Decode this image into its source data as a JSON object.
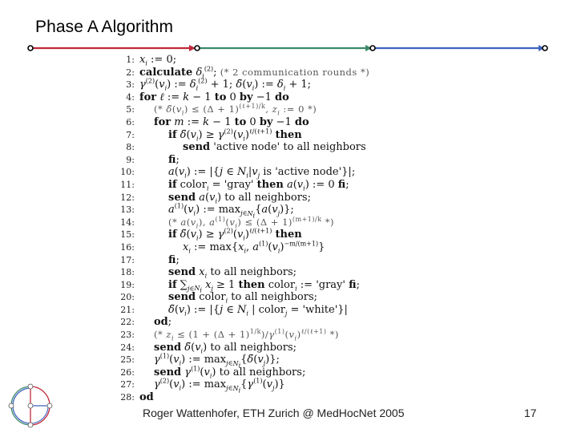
{
  "slide": {
    "title": "Phase A Algorithm",
    "footer": "Roger Wattenhofer, ETH Zurich @ MedHocNet 2005",
    "page_number": "17",
    "decor_colors": {
      "red": "#c0283a",
      "green": "#3a8a6a",
      "blue": "#3f63c0"
    }
  },
  "algorithm": {
    "lines": [
      {
        "n": "1:",
        "indent": 0,
        "html": "<i>x<sub>i</sub></i> := 0;"
      },
      {
        "n": "2:",
        "indent": 0,
        "html": "<b>calculate</b> <i>δ<sub>i</sub></i><sup>(2)</sup>; <span class='comment'>(* 2 communication rounds *)</span>"
      },
      {
        "n": "3:",
        "indent": 0,
        "html": "<i>γ</i><sup>(2)</sup>(<i>v<sub>i</sub></i>) := <i>δ<sub>i</sub></i><sup>(2)</sup> + 1; <i>δ̃</i>(<i>v<sub>i</sub></i>) := <i>δ<sub>i</sub></i> + 1;"
      },
      {
        "n": "4:",
        "indent": 0,
        "html": "<b>for</b> <i>ℓ</i> := <i>k</i> − 1 <b>to</b> 0 <b>by</b> −1 <b>do</b>"
      },
      {
        "n": "5:",
        "indent": 1,
        "html": "<span class='comment'>(* <i>δ̃</i>(<i>v<sub>i</sub></i>) ≤ (Δ + 1)<sup>(ℓ+1)/k</sup>, <i>z<sub>i</sub></i> := 0 *)</span>"
      },
      {
        "n": "6:",
        "indent": 1,
        "html": "<b>for</b> <i>m</i> := <i>k</i> − 1 <b>to</b> 0 <b>by</b> −1 <b>do</b>"
      },
      {
        "n": "7:",
        "indent": 2,
        "html": "<b>if</b> <i>δ̃</i>(<i>v<sub>i</sub></i>) ≥ <i>γ</i><sup>(2)</sup>(<i>v<sub>i</sub></i>)<sup>ℓ/(ℓ+1)</sup> <b>then</b>"
      },
      {
        "n": "8:",
        "indent": 3,
        "html": "<b>send</b> 'active node' to all neighbors"
      },
      {
        "n": "9:",
        "indent": 2,
        "html": "<b>fi</b>;"
      },
      {
        "n": "10:",
        "indent": 2,
        "html": "<i>a</i>(<i>v<sub>i</sub></i>) := |{<i>j</i> ∈ <i>N<sub>i</sub></i>|<i>v<sub>j</sub></i> is 'active node'}|;"
      },
      {
        "n": "11:",
        "indent": 2,
        "html": "<b>if</b> color<sub><i>i</i></sub> = 'gray' <b>then</b> <i>a</i>(<i>v<sub>i</sub></i>) := 0 <b>fi</b>;"
      },
      {
        "n": "12:",
        "indent": 2,
        "html": "<b>send</b> <i>a</i>(<i>v<sub>i</sub></i>) to all neighbors;"
      },
      {
        "n": "13:",
        "indent": 2,
        "html": "<i>a</i><sup>(1)</sup>(<i>v<sub>i</sub></i>) := max<sub><i>j</i>∈<i>N<sub>i</sub></i></sub>{<i>a</i>(<i>v<sub>j</sub></i>)};"
      },
      {
        "n": "14:",
        "indent": 2,
        "html": "<span class='comment'>(* <i>a</i>(<i>v<sub>i</sub></i>), <i>a</i><sup>(1)</sup>(<i>v<sub>i</sub></i>) ≤ (Δ + 1)<sup>(m+1)/k</sup> *)</span>"
      },
      {
        "n": "15:",
        "indent": 2,
        "html": "<b>if</b> <i>δ̃</i>(<i>v<sub>i</sub></i>) ≥ <i>γ</i><sup>(2)</sup>(<i>v<sub>i</sub></i>)<sup>ℓ/(ℓ+1)</sup> <b>then</b>"
      },
      {
        "n": "16:",
        "indent": 3,
        "html": "<i>x<sub>i</sub></i> := max{<i>x<sub>i</sub></i>, <i>a</i><sup>(1)</sup>(<i>v<sub>i</sub></i>)<sup>−m/(m+1)</sup>}"
      },
      {
        "n": "17:",
        "indent": 2,
        "html": "<b>fi</b>;"
      },
      {
        "n": "18:",
        "indent": 2,
        "html": "<b>send</b> <i>x<sub>i</sub></i> to all neighbors;"
      },
      {
        "n": "19:",
        "indent": 2,
        "html": "<b>if</b> ∑<sub><i>j</i>∈<i>N<sub>i</sub></i></sub> <i>x<sub>j</sub></i> ≥ 1 <b>then</b> color<sub><i>i</i></sub> := 'gray' <b>fi</b>;"
      },
      {
        "n": "20:",
        "indent": 2,
        "html": "<b>send</b> color<sub><i>i</i></sub> to all neighbors;"
      },
      {
        "n": "21:",
        "indent": 2,
        "html": "<i>δ̃</i>(<i>v<sub>i</sub></i>) := |{<i>j</i> ∈ <i>N<sub>i</sub></i> | color<sub><i>j</i></sub> = 'white'}|"
      },
      {
        "n": "22:",
        "indent": 1,
        "html": "<b>od</b>;"
      },
      {
        "n": "23:",
        "indent": 1,
        "html": "<span class='comment'>(* <i>z<sub>i</sub></i> ≤ (1 + (Δ + 1)<sup>1/k</sup>)/<i>γ</i><sup>(1)</sup>(<i>v<sub>i</sub></i>)<sup>ℓ/(ℓ+1)</sup> *)</span>"
      },
      {
        "n": "24:",
        "indent": 1,
        "html": "<b>send</b> <i>δ̃</i>(<i>v<sub>i</sub></i>) to all neighbors;"
      },
      {
        "n": "25:",
        "indent": 1,
        "html": "<i>γ</i><sup>(1)</sup>(<i>v<sub>i</sub></i>) := max<sub><i>j</i>∈<i>N<sub>i</sub></i></sub>{<i>δ̃</i>(<i>v<sub>j</sub></i>)};"
      },
      {
        "n": "26:",
        "indent": 1,
        "html": "<b>send</b> <i>γ</i><sup>(1)</sup>(<i>v<sub>i</sub></i>) to all neighbors;"
      },
      {
        "n": "27:",
        "indent": 1,
        "html": "<i>γ</i><sup>(2)</sup>(<i>v<sub>i</sub></i>) := max<sub><i>j</i>∈<i>N<sub>i</sub></i></sub>{<i>γ</i><sup>(1)</sup>(<i>v<sub>j</sub></i>)}"
      },
      {
        "n": "28:",
        "indent": 0,
        "html": "<b>od</b>"
      }
    ]
  }
}
